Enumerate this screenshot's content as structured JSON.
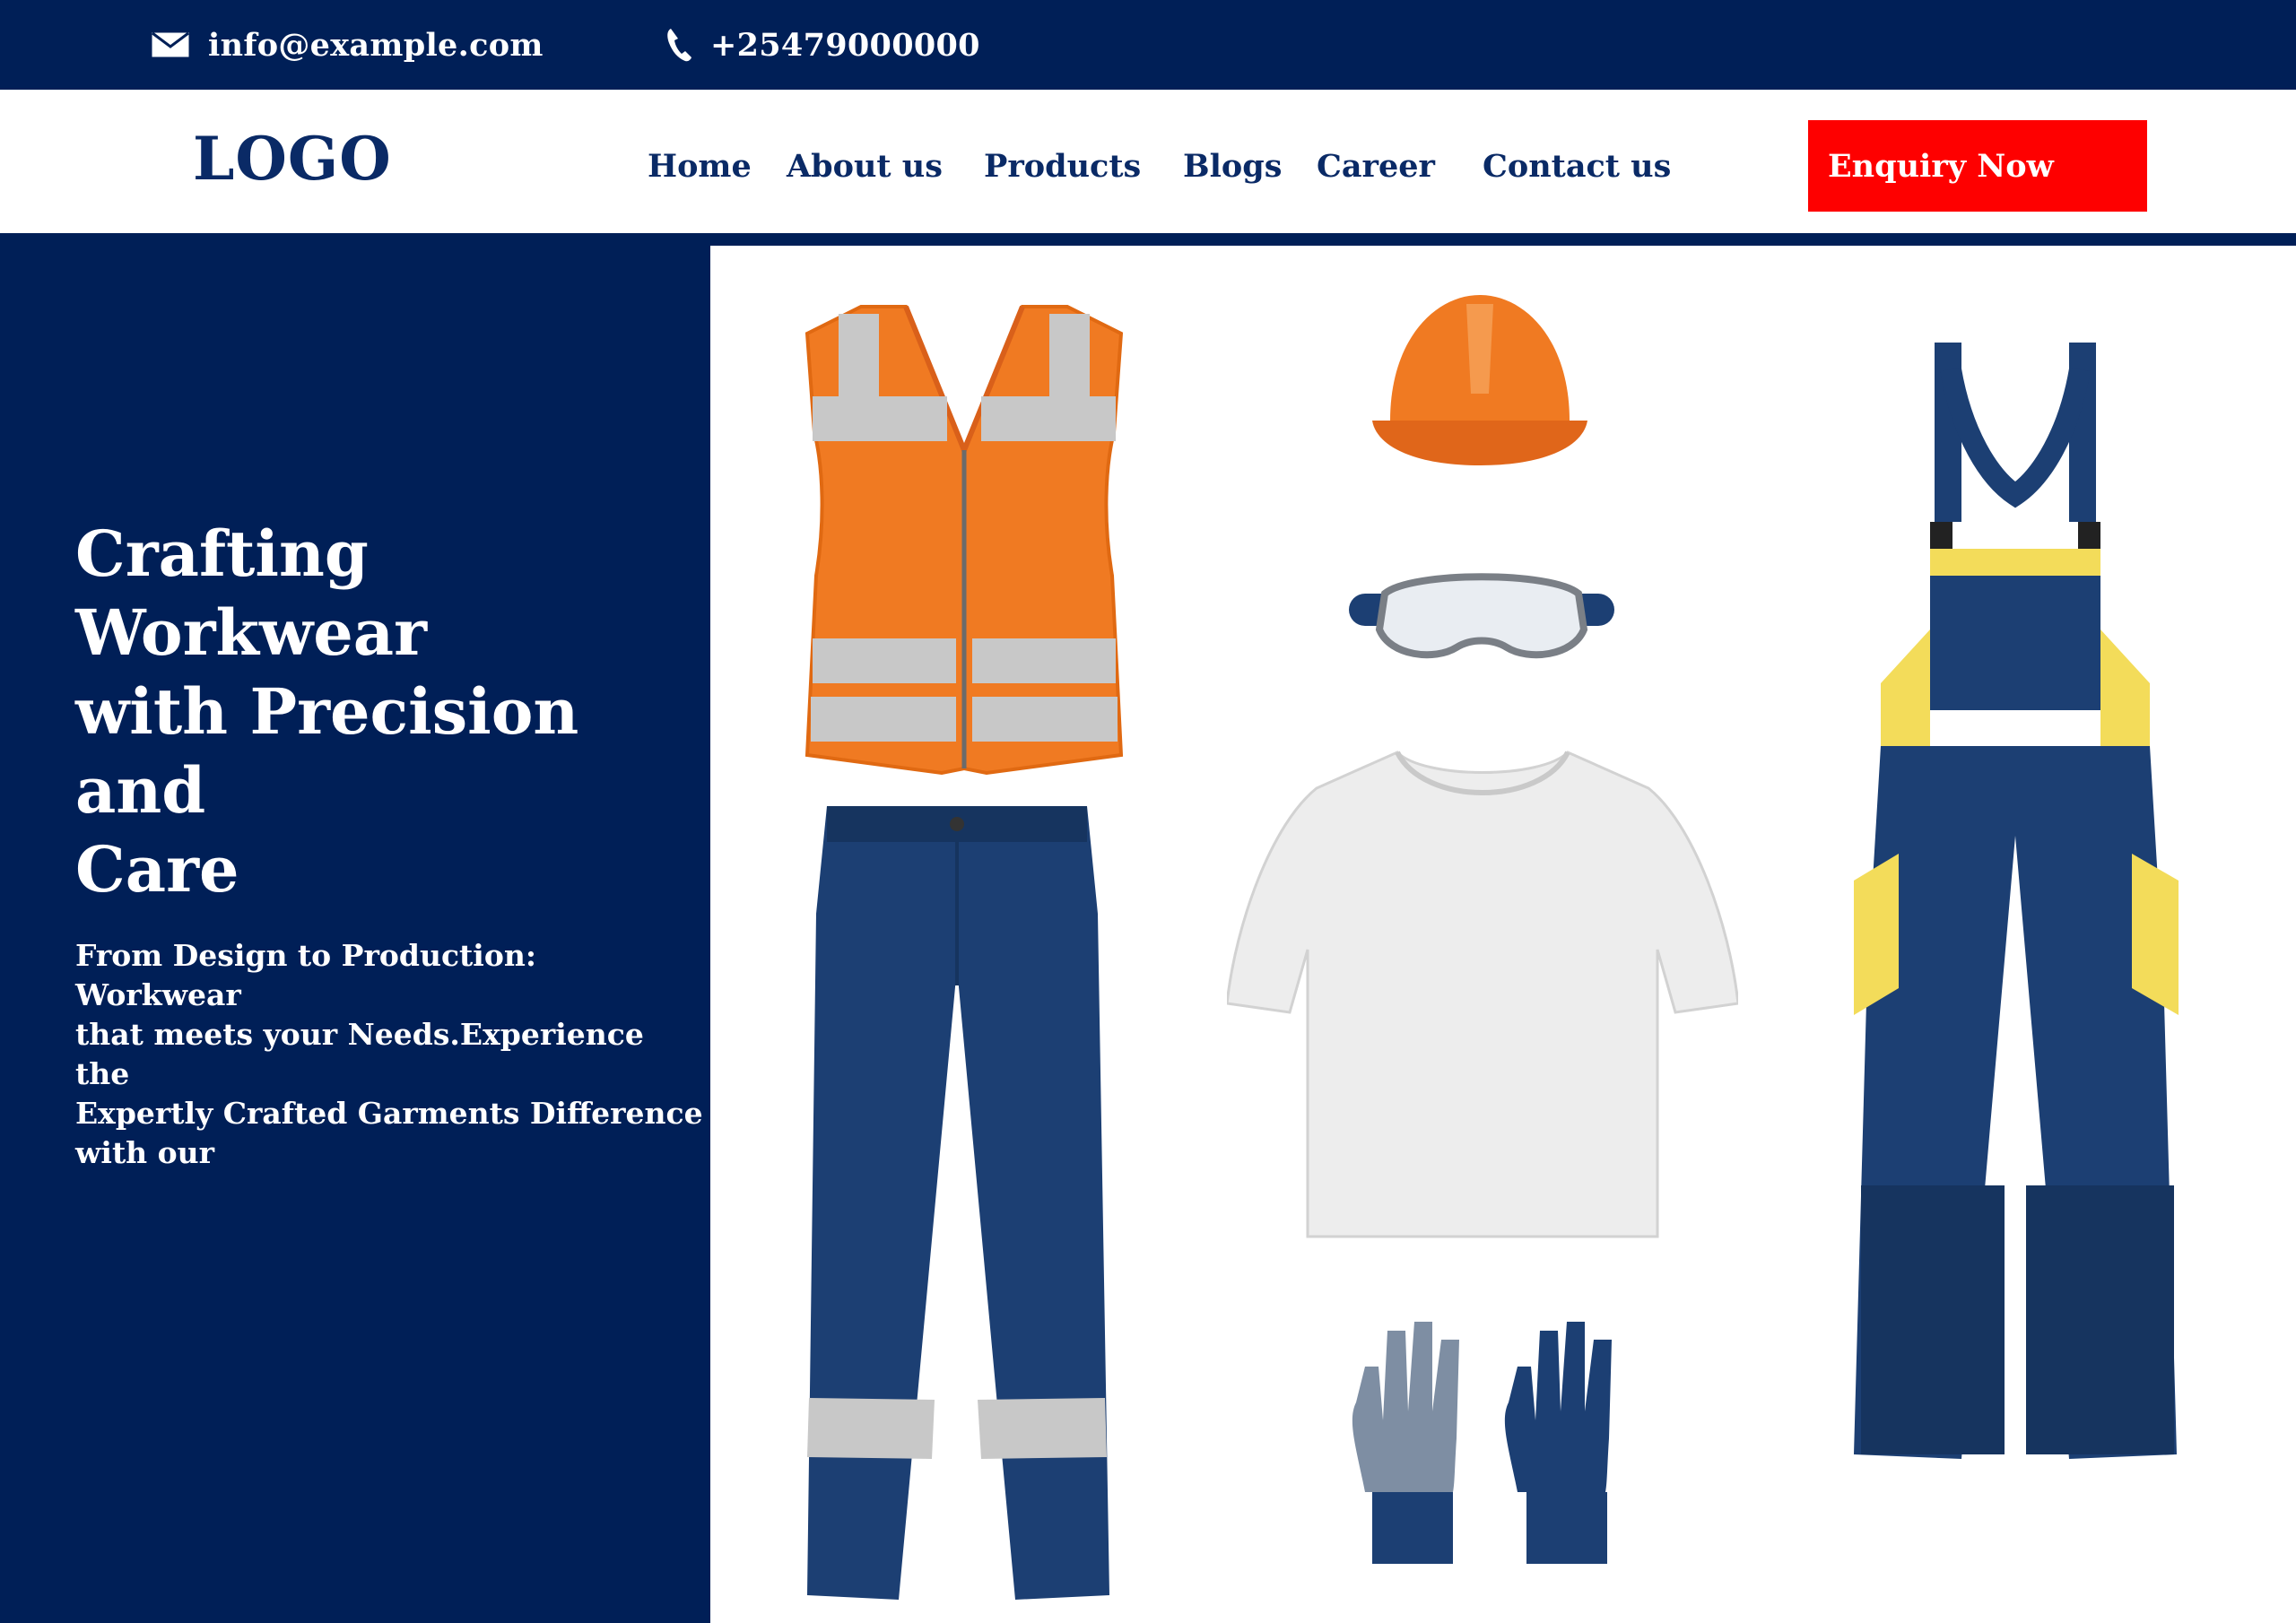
{
  "topbar": {
    "email": "info@example.com",
    "phone": "+25479000000"
  },
  "header": {
    "logo": "LOGO",
    "nav": [
      "Home",
      "About us",
      "Products",
      "Blogs",
      "Career",
      "Contact us"
    ],
    "cta_label": "Enquiry  Now"
  },
  "hero": {
    "title": "Crafting  Workwear\nwith Precision and\nCare",
    "subtitle": "From Design to Production: Workwear\nthat meets your Needs.Experience the\n Expertly Crafted Garments Difference\n with our"
  },
  "colors": {
    "navy": "#001f57",
    "nav_text": "#0a2a66",
    "cta": "#fe0000",
    "vest_orange": "#f07a22",
    "reflective": "#c8c8c8",
    "workwear_blue": "#1c3f73",
    "accent_yellow": "#f3dc5a"
  },
  "products": [
    {
      "icon": "safety-vest-icon"
    },
    {
      "icon": "hard-hat-icon"
    },
    {
      "icon": "safety-goggles-icon"
    },
    {
      "icon": "t-shirt-icon"
    },
    {
      "icon": "work-trousers-icon"
    },
    {
      "icon": "work-gloves-icon"
    },
    {
      "icon": "overalls-icon"
    }
  ]
}
